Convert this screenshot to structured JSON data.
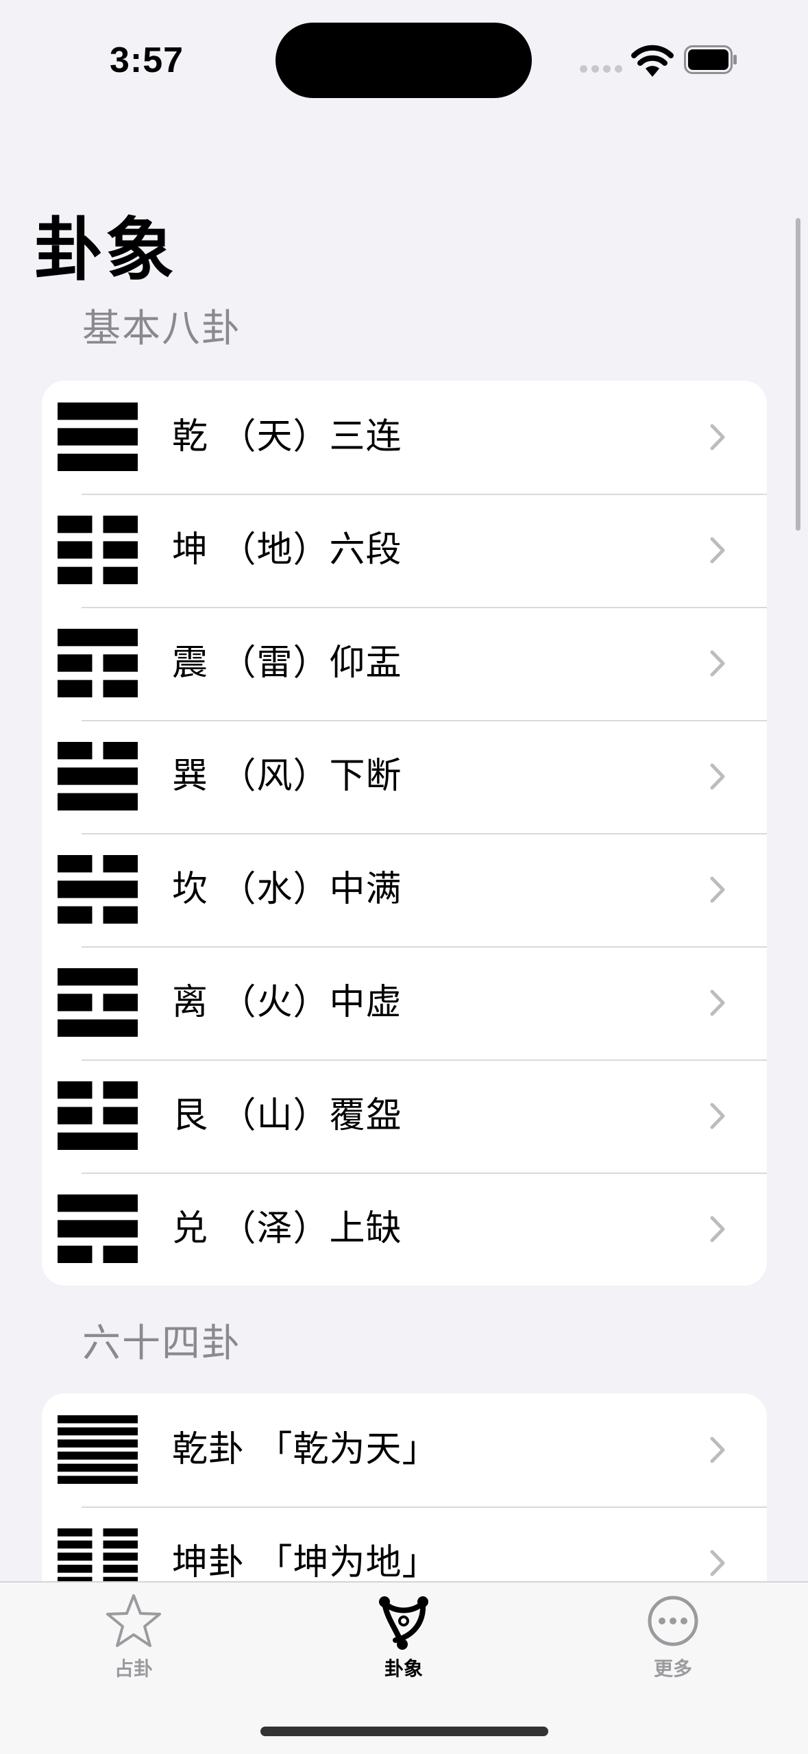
{
  "status_bar": {
    "time": "3:57"
  },
  "page_title": "卦象",
  "sections": {
    "basic": {
      "header": "基本八卦",
      "rows": [
        {
          "label": "乾 （天）三连",
          "lines": [
            1,
            1,
            1
          ]
        },
        {
          "label": "坤 （地）六段",
          "lines": [
            0,
            0,
            0
          ]
        },
        {
          "label": "震 （雷）仰盂",
          "lines": [
            0,
            0,
            1
          ]
        },
        {
          "label": "巽 （风）下断",
          "lines": [
            1,
            1,
            0
          ]
        },
        {
          "label": "坎 （水）中满",
          "lines": [
            0,
            1,
            0
          ]
        },
        {
          "label": "离 （火）中虚",
          "lines": [
            1,
            0,
            1
          ]
        },
        {
          "label": "艮 （山）覆盌",
          "lines": [
            1,
            0,
            0
          ]
        },
        {
          "label": "兑 （泽）上缺",
          "lines": [
            0,
            1,
            1
          ]
        }
      ]
    },
    "sixty_four": {
      "header": "六十四卦",
      "rows": [
        {
          "label": "乾卦 「乾为天」",
          "lines": [
            1,
            1,
            1,
            1,
            1,
            1
          ]
        },
        {
          "label": "坤卦 「坤为地」",
          "lines": [
            0,
            0,
            0,
            0,
            0,
            0
          ]
        }
      ]
    }
  },
  "tabbar": {
    "items": [
      {
        "label": "占卦",
        "icon": "star-icon",
        "active": false
      },
      {
        "label": "卦象",
        "icon": "trigram-emblem-icon",
        "active": true
      },
      {
        "label": "更多",
        "icon": "ellipsis-circle-icon",
        "active": false
      }
    ]
  }
}
